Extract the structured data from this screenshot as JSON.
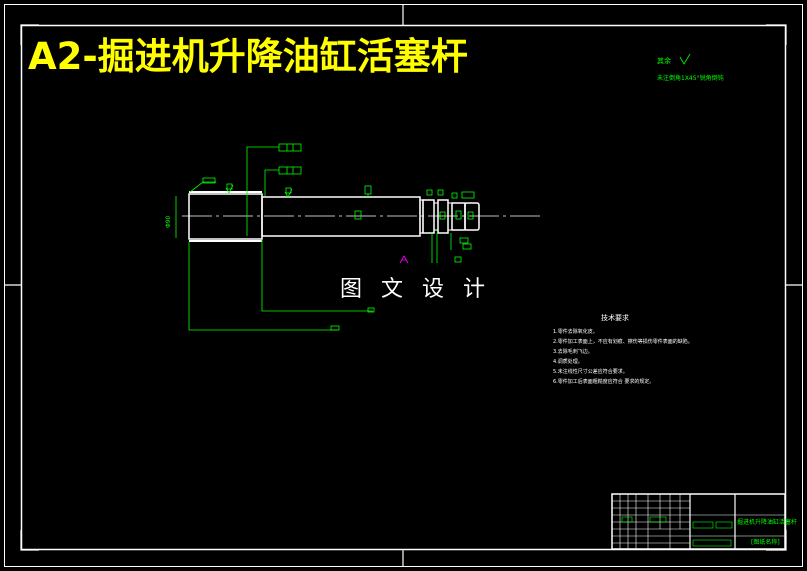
{
  "title": "A2-掘进机升降油缸活塞杆",
  "watermark": "图 文 设 计",
  "roughness_note": {
    "line1": "其余",
    "line2": "未注倒角1X45°锐角倒钝"
  },
  "tech_requirements": {
    "heading": "技术要求",
    "items": [
      "1.零件去除氧化皮。",
      "2.零件加工表面上，不应有划痕、擦伤等损伤零件表面的缺陷。",
      "3.去除毛刺飞边。",
      "4.调质处理。",
      "5.未注线性尺寸公差应符合要求。",
      "6.零件加工后表面粗糙度应符合 要求的规定。"
    ]
  },
  "title_block": {
    "part_name": "掘进机升降油缸活塞杆",
    "drawing_no": "[图纸名称]"
  },
  "colors": {
    "background": "#000000",
    "frame": "#ffffff",
    "annotation": "#00ff00",
    "title": "#ffff00",
    "marker": "#ff00ff"
  }
}
